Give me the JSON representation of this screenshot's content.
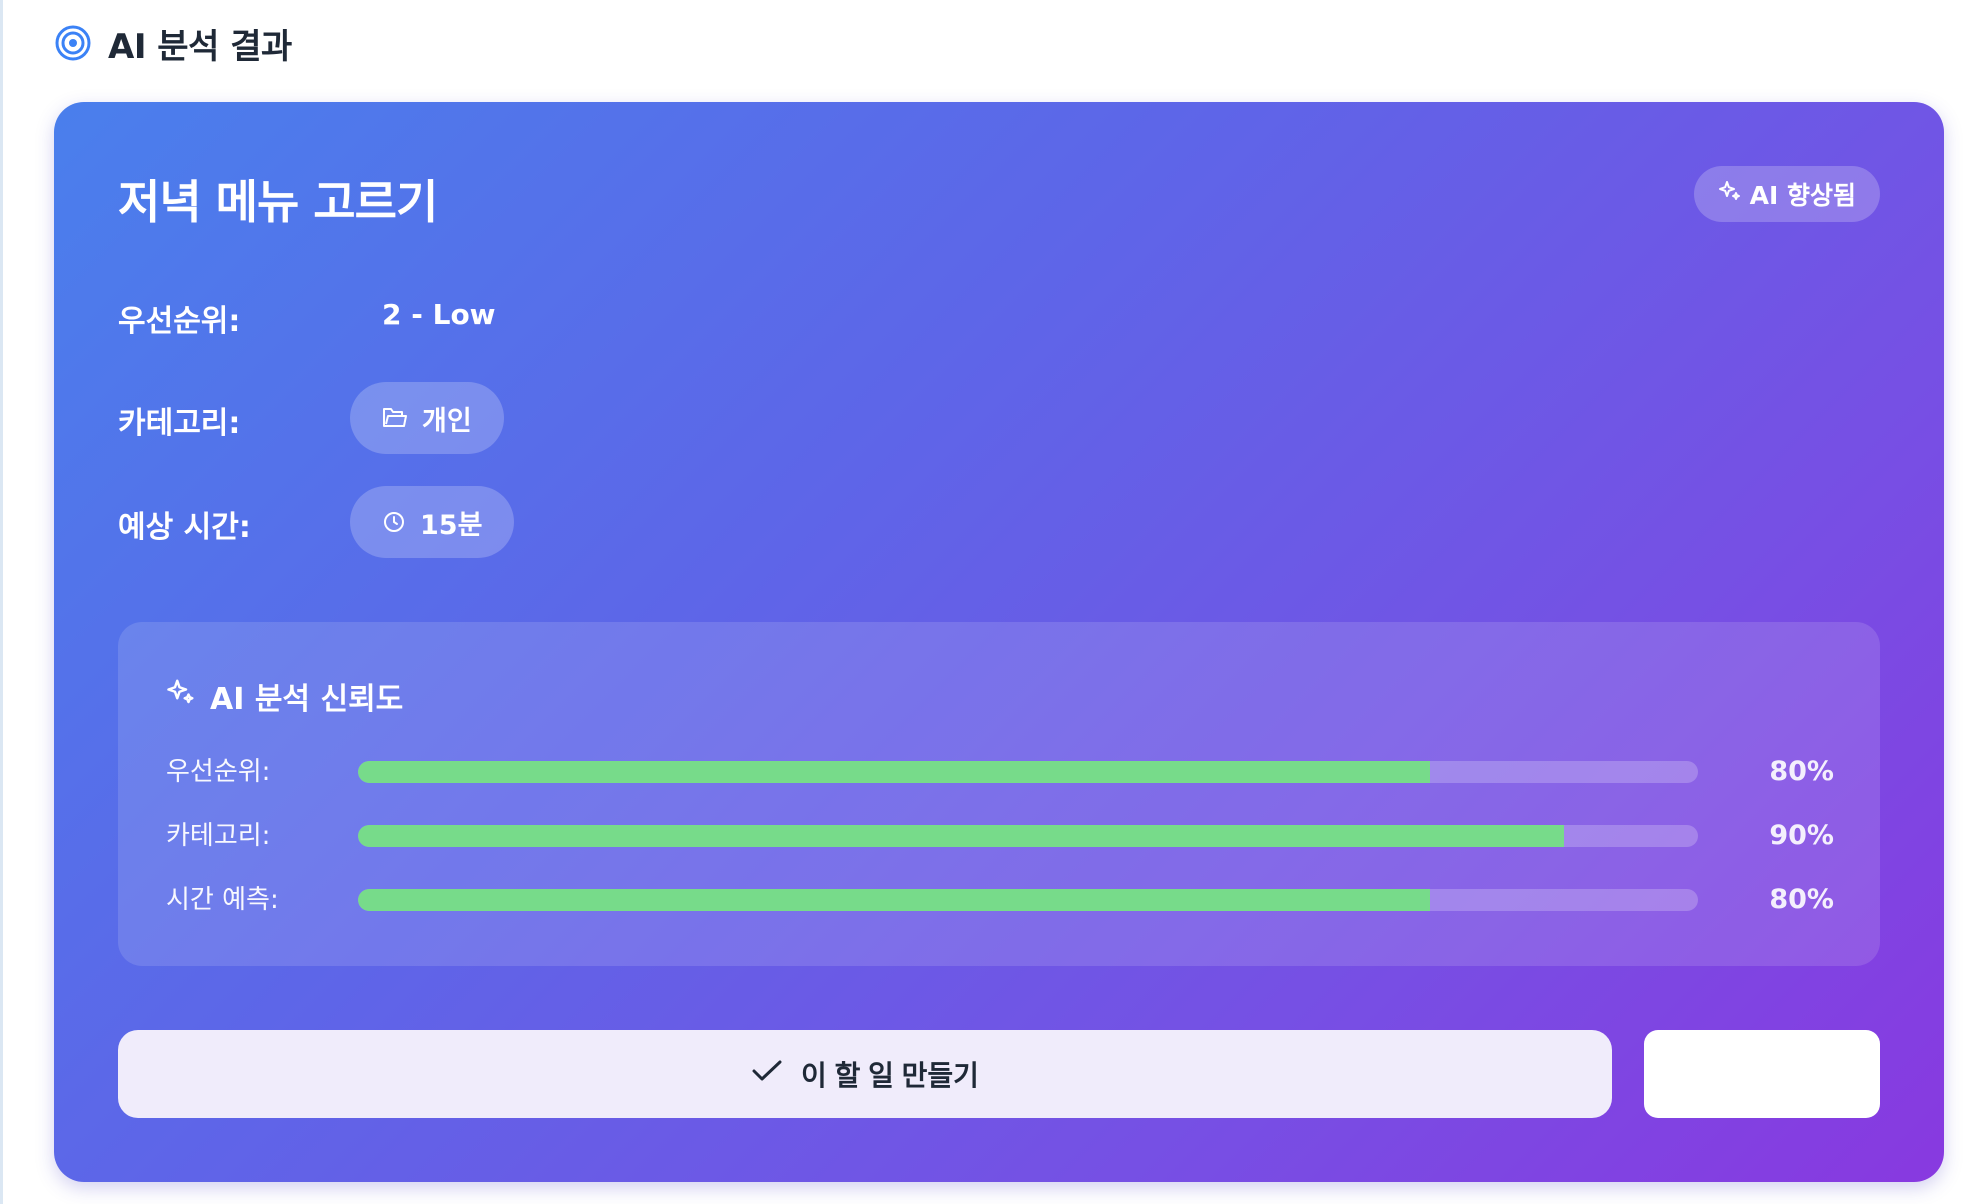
{
  "header": {
    "title": "AI 분석 결과",
    "icon": "target-icon"
  },
  "card": {
    "title": "저녁 메뉴 고르기",
    "badge": "AI 향상됨",
    "badge_icon": "sparkles-icon",
    "fields": {
      "priority_label": "우선순위:",
      "priority_value": "2 - Low",
      "category_label": "카테고리:",
      "category_value": "개인",
      "category_icon": "folder-icon",
      "time_label": "예상 시간:",
      "time_value": "15분",
      "time_icon": "clock-icon"
    }
  },
  "confidence": {
    "title": "AI 분석 신뢰도",
    "icon": "sparkles-icon",
    "rows": [
      {
        "label": "우선순위:",
        "value": 0.8,
        "text": "80%"
      },
      {
        "label": "카테고리:",
        "value": 0.9,
        "text": "90%"
      },
      {
        "label": "시간 예측:",
        "value": 0.8,
        "text": "80%"
      }
    ],
    "bar_color": "#77db8a"
  },
  "actions": {
    "create_label": "이 할 일 만들기",
    "create_icon": "check-icon"
  },
  "colors": {
    "gradient_start": "#4a7fec",
    "gradient_end": "#8839e0",
    "header_icon": "#3b82f6"
  }
}
